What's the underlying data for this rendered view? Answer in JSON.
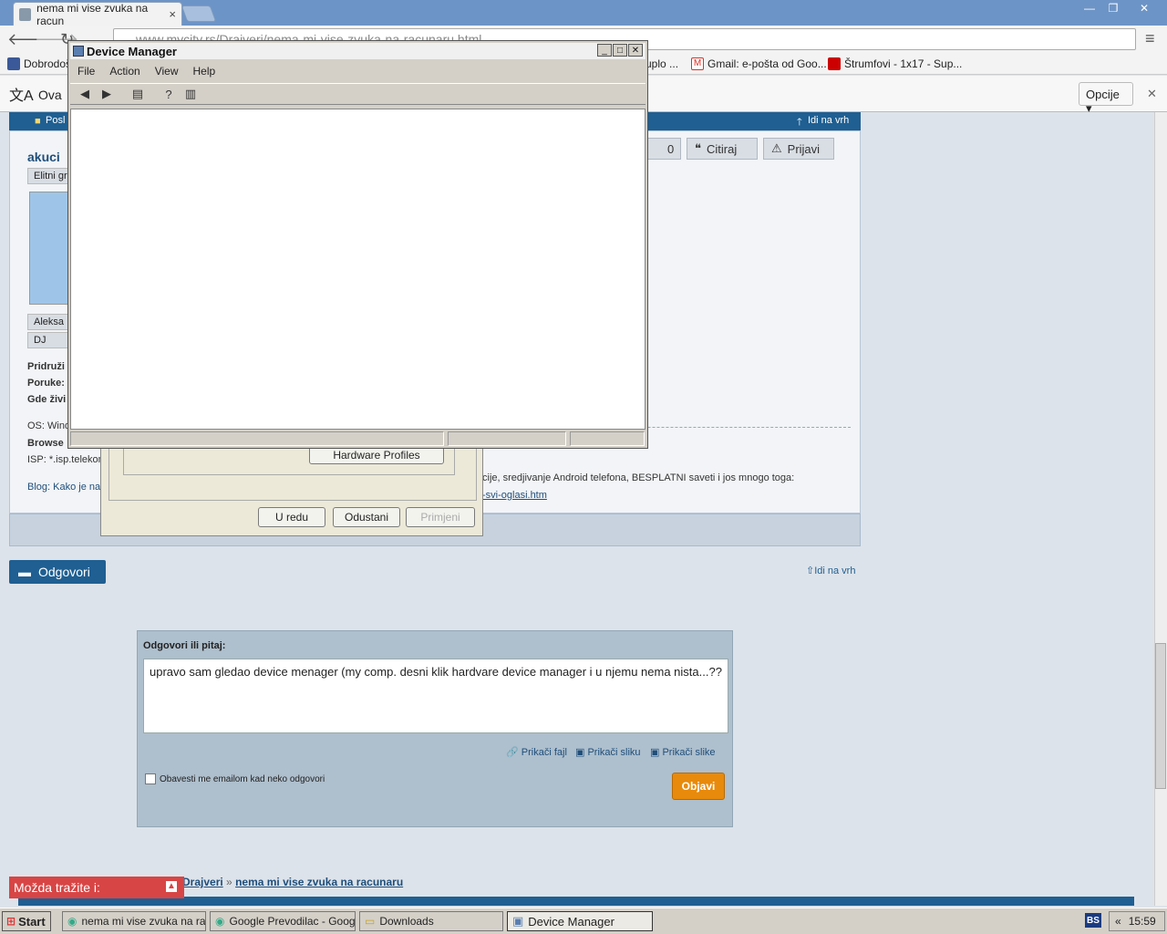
{
  "browser": {
    "tabs": [
      {
        "label": "nema mi vise zvuka na racun",
        "close": "×"
      },
      {
        "label": ""
      }
    ],
    "window_controls": {
      "minimize": "—",
      "maximize": "❐",
      "close": "✕"
    },
    "url": "www.mycity.rs/Drajveri/nema-mi-vise-zvuka-na-racunaru.html",
    "bookmarks": [
      {
        "label": "Dobrodoš",
        "icon": "facebook-icon",
        "color": "#3b5998"
      },
      {
        "label": "uplo ...",
        "icon": "page-icon",
        "color": "#999999"
      },
      {
        "label": "Gmail: e-pošta od Goo...",
        "icon": "gmail-icon",
        "color": "#d93025"
      },
      {
        "label": "Štrumfovi - 1x17 - Sup...",
        "icon": "youtube-icon",
        "color": "#cc0000"
      }
    ],
    "translate_bar": {
      "text": "Ova",
      "options_label": "Opcije ▾",
      "close": "✕"
    }
  },
  "post": {
    "author": "akuci",
    "rank": "Elitni gr",
    "badge1": "Aleksa",
    "badge2": "DJ",
    "labels": [
      "Pridruži",
      "Poruke:",
      "Gde živi",
      "OS: Wind",
      "Browse",
      "ISP: *.isp.telekom",
      "Blog: Kako je na"
    ],
    "top_bar_left": "Posl",
    "top_bar_right": "Idi na vrh",
    "vote_count": "0",
    "cite_label": "Citiraj",
    "report_label": "Prijavi",
    "signature_text": "cije, sredjivanje Android telefona, BESPLATNI saveti i jos mnogo toga:",
    "signature_link": "-svi-oglasi.htm"
  },
  "page": {
    "reply_button": "Odgovori",
    "go_top": "Idi na vrh",
    "reply_title": "Odgovori ili pitaj:",
    "reply_text": "upravo sam gledao device menager (my comp. desni klik hardvare device manager i u njemu nema nista...??",
    "attach_file": "Prikači fajl",
    "attach_image": "Prikači sliku",
    "attach_images": "Prikači slike",
    "notify_label": "Obavesti me emailom kad neko odgovori",
    "publish": "Objavi",
    "breadcrumb1": "Drajveri",
    "breadcrumb_sep": "»",
    "breadcrumb2": "nema mi vise zvuka na racunaru",
    "maybe_search": "Možda tražite i:"
  },
  "props_dialog": {
    "hardware_profiles": "Hardware Profiles",
    "ok": "U redu",
    "cancel": "Odustani",
    "apply": "Primjeni"
  },
  "device_manager": {
    "title": "Device Manager",
    "menu": [
      "File",
      "Action",
      "View",
      "Help"
    ]
  },
  "taskbar": {
    "start": "Start",
    "tasks": [
      "nema mi vise zvuka na ra...",
      "Google Prevodilac - Goog...",
      "Downloads",
      "Device Manager"
    ],
    "lang": "BS",
    "clock": "15:59",
    "tray_arrow": "«"
  }
}
